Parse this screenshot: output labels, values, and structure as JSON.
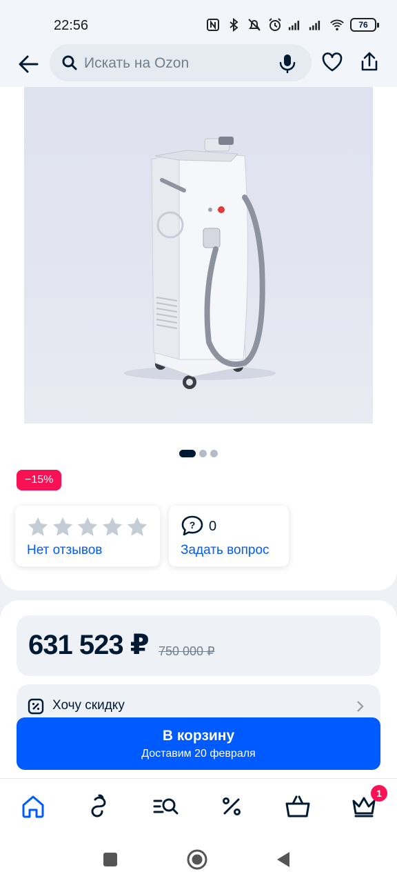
{
  "status_bar": {
    "time": "22:56",
    "battery": "76"
  },
  "header": {
    "search_placeholder": "Искать на Ozon"
  },
  "gallery": {
    "total_images": 3,
    "active_index": 0
  },
  "product": {
    "discount_badge": "−15%",
    "reviews_label": "Нет отзывов",
    "rating": 0,
    "questions_count": "0",
    "ask_label": "Задать вопрос",
    "price": "631 523 ₽",
    "old_price": "750 000 ₽",
    "want_discount_label": "Хочу скидку"
  },
  "cart_button": {
    "label": "В корзину",
    "delivery": "Доставим 20 февраля"
  },
  "tabbar": {
    "items": [
      "home-tab",
      "fresh-tab",
      "catalog-tab",
      "sales-tab",
      "cart-tab",
      "premium-tab"
    ],
    "premium_badge": "1"
  },
  "colors": {
    "accent": "#005bff",
    "sale": "#f91155",
    "text": "#001a34"
  }
}
